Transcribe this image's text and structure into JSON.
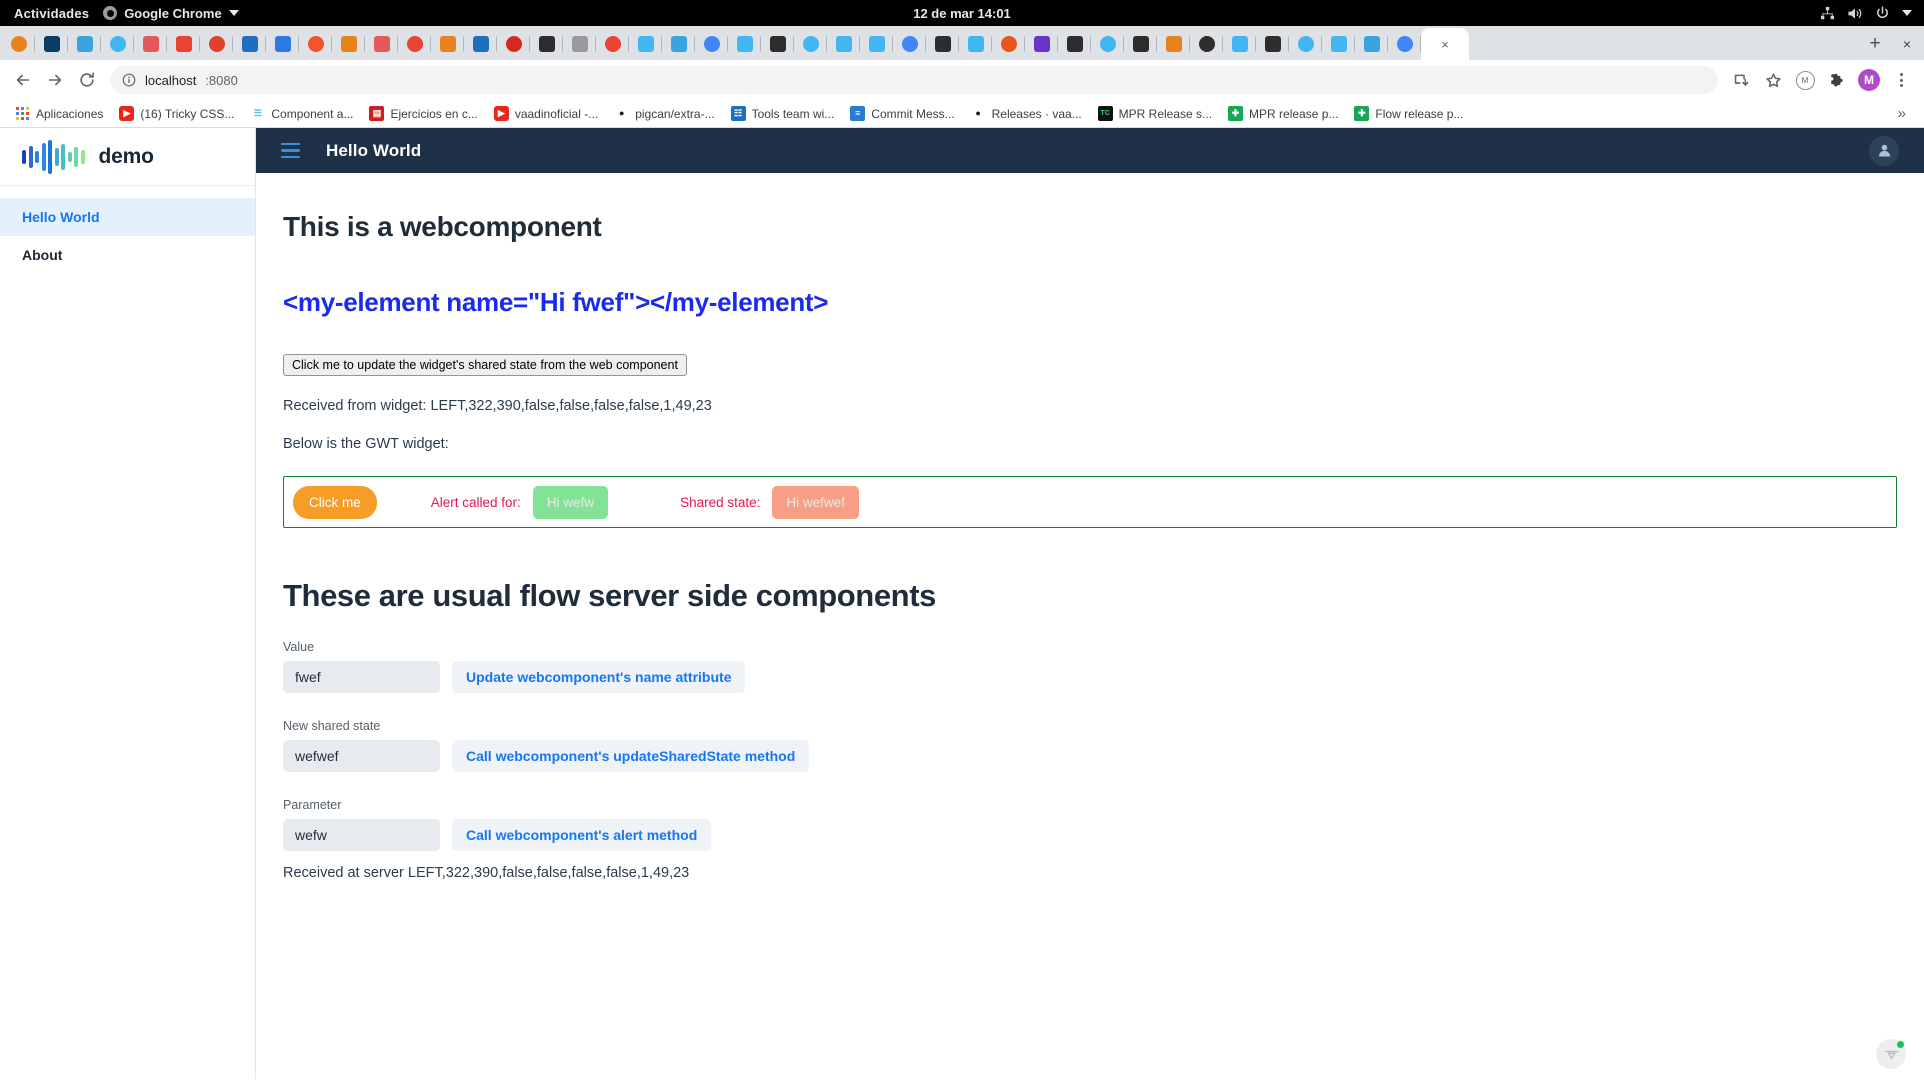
{
  "os": {
    "activities": "Actividades",
    "app_menu": "Google Chrome",
    "clock": "12 de mar  14:01",
    "tray": [
      "network-icon",
      "volume-icon",
      "power-icon",
      "caret-down-icon"
    ]
  },
  "browser": {
    "tabs_count": 44,
    "active_tab_close": "×",
    "new_tab_label": "+",
    "window_close_label": "×",
    "nav": {
      "back": "←",
      "forward": "→",
      "reload": "⟳"
    },
    "omnibox": {
      "host": "localhost",
      "port": ":8080",
      "info_icon": "site-info-icon"
    },
    "toolbar_right": {
      "install_icon": "install-app-icon",
      "bookmark_icon": "star-icon",
      "extension_label": "M",
      "puzzle_icon": "extensions-puzzle-icon",
      "profile_label": "M",
      "menu_icon": "three-dot-menu-icon"
    },
    "bookmarks": [
      {
        "label": "Aplicaciones",
        "icon": "apps-grid-icon"
      },
      {
        "label": "(16) Tricky CSS...",
        "icon": "youtube-icon"
      },
      {
        "label": "Component a...",
        "icon": "vaadin-icon"
      },
      {
        "label": "Ejercicios en c...",
        "icon": "redbook-icon"
      },
      {
        "label": "vaadinoficial -...",
        "icon": "youtube-icon"
      },
      {
        "label": "pigcan/extra-...",
        "icon": "github-icon"
      },
      {
        "label": "Tools team wi...",
        "icon": "confluence-icon"
      },
      {
        "label": "Commit Mess...",
        "icon": "doc-icon"
      },
      {
        "label": "Releases · vaa...",
        "icon": "github-icon"
      },
      {
        "label": "MPR Release s...",
        "icon": "terminal-icon"
      },
      {
        "label": "MPR release p...",
        "icon": "sheets-icon"
      },
      {
        "label": "Flow release p...",
        "icon": "sheets-icon"
      }
    ],
    "bookmarks_overflow": "»"
  },
  "app": {
    "brand": "demo",
    "sidebar": [
      {
        "label": "Hello World",
        "active": true
      },
      {
        "label": "About",
        "active": false
      }
    ],
    "appbar": {
      "menu_icon": "hamburger-menu-icon",
      "title": "Hello World",
      "avatar_icon": "user-avatar-icon"
    },
    "main": {
      "heading1": "This is a webcomponent",
      "element_markup": "<my-element name=\"Hi fwef\"></my-element>",
      "native_button": "Click me to update the widget's shared state from the web component",
      "received_from_widget": "Received from widget: LEFT,322,390,false,false,false,false,1,49,23",
      "below_gwt": "Below is the GWT widget:",
      "gwt": {
        "click_button": "Click me",
        "alert_label": "Alert called for:",
        "alert_value": "Hi wefw",
        "shared_label": "Shared state:",
        "shared_value": "Hi wefwef"
      },
      "heading2": "These are usual flow server side components",
      "fields": [
        {
          "label": "Value",
          "value": "fwef",
          "button": "Update webcomponent's name attribute"
        },
        {
          "label": "New shared state",
          "value": "wefwef",
          "button": "Call webcomponent's updateSharedState method"
        },
        {
          "label": "Parameter",
          "value": "wefw",
          "button": "Call webcomponent's alert method"
        }
      ],
      "received_at_server": "Received at server LEFT,322,390,false,false,false,false,1,49,23"
    },
    "devtools": {
      "icon": "vaadin-devtools-icon",
      "status": "connected"
    }
  },
  "colors": {
    "appbar_bg": "#1f3146",
    "accent_blue": "#1676f3",
    "element_blue": "#1a2bec",
    "gwt_border": "#14802b",
    "gwt_button": "#f89c28",
    "gwt_label": "#e8174e",
    "chip_green": "#82e396",
    "chip_salmon": "#f79f84",
    "devtools_status": "#18c25a",
    "profile_purple": "#b14ac7"
  }
}
